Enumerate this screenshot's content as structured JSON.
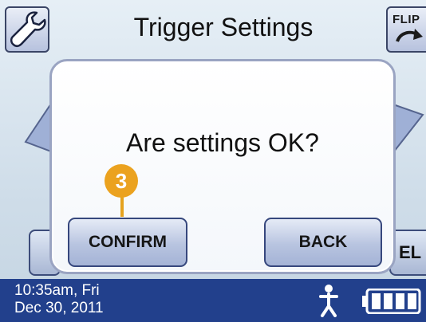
{
  "header": {
    "title": "Trigger Settings",
    "wrench_icon": "wrench-icon",
    "flip_label": "FLIP"
  },
  "background": {
    "right_button_fragment": "EL"
  },
  "dialog": {
    "message": "Are settings OK?",
    "confirm_label": "CONFIRM",
    "back_label": "BACK"
  },
  "callout": {
    "number": "3",
    "color": "#eba21f"
  },
  "status_bar": {
    "time": "10:35am, Fri",
    "date": "Dec 30, 2011",
    "person_icon": "person-icon",
    "battery_icon": "battery-icon",
    "background_color": "#22408c"
  }
}
